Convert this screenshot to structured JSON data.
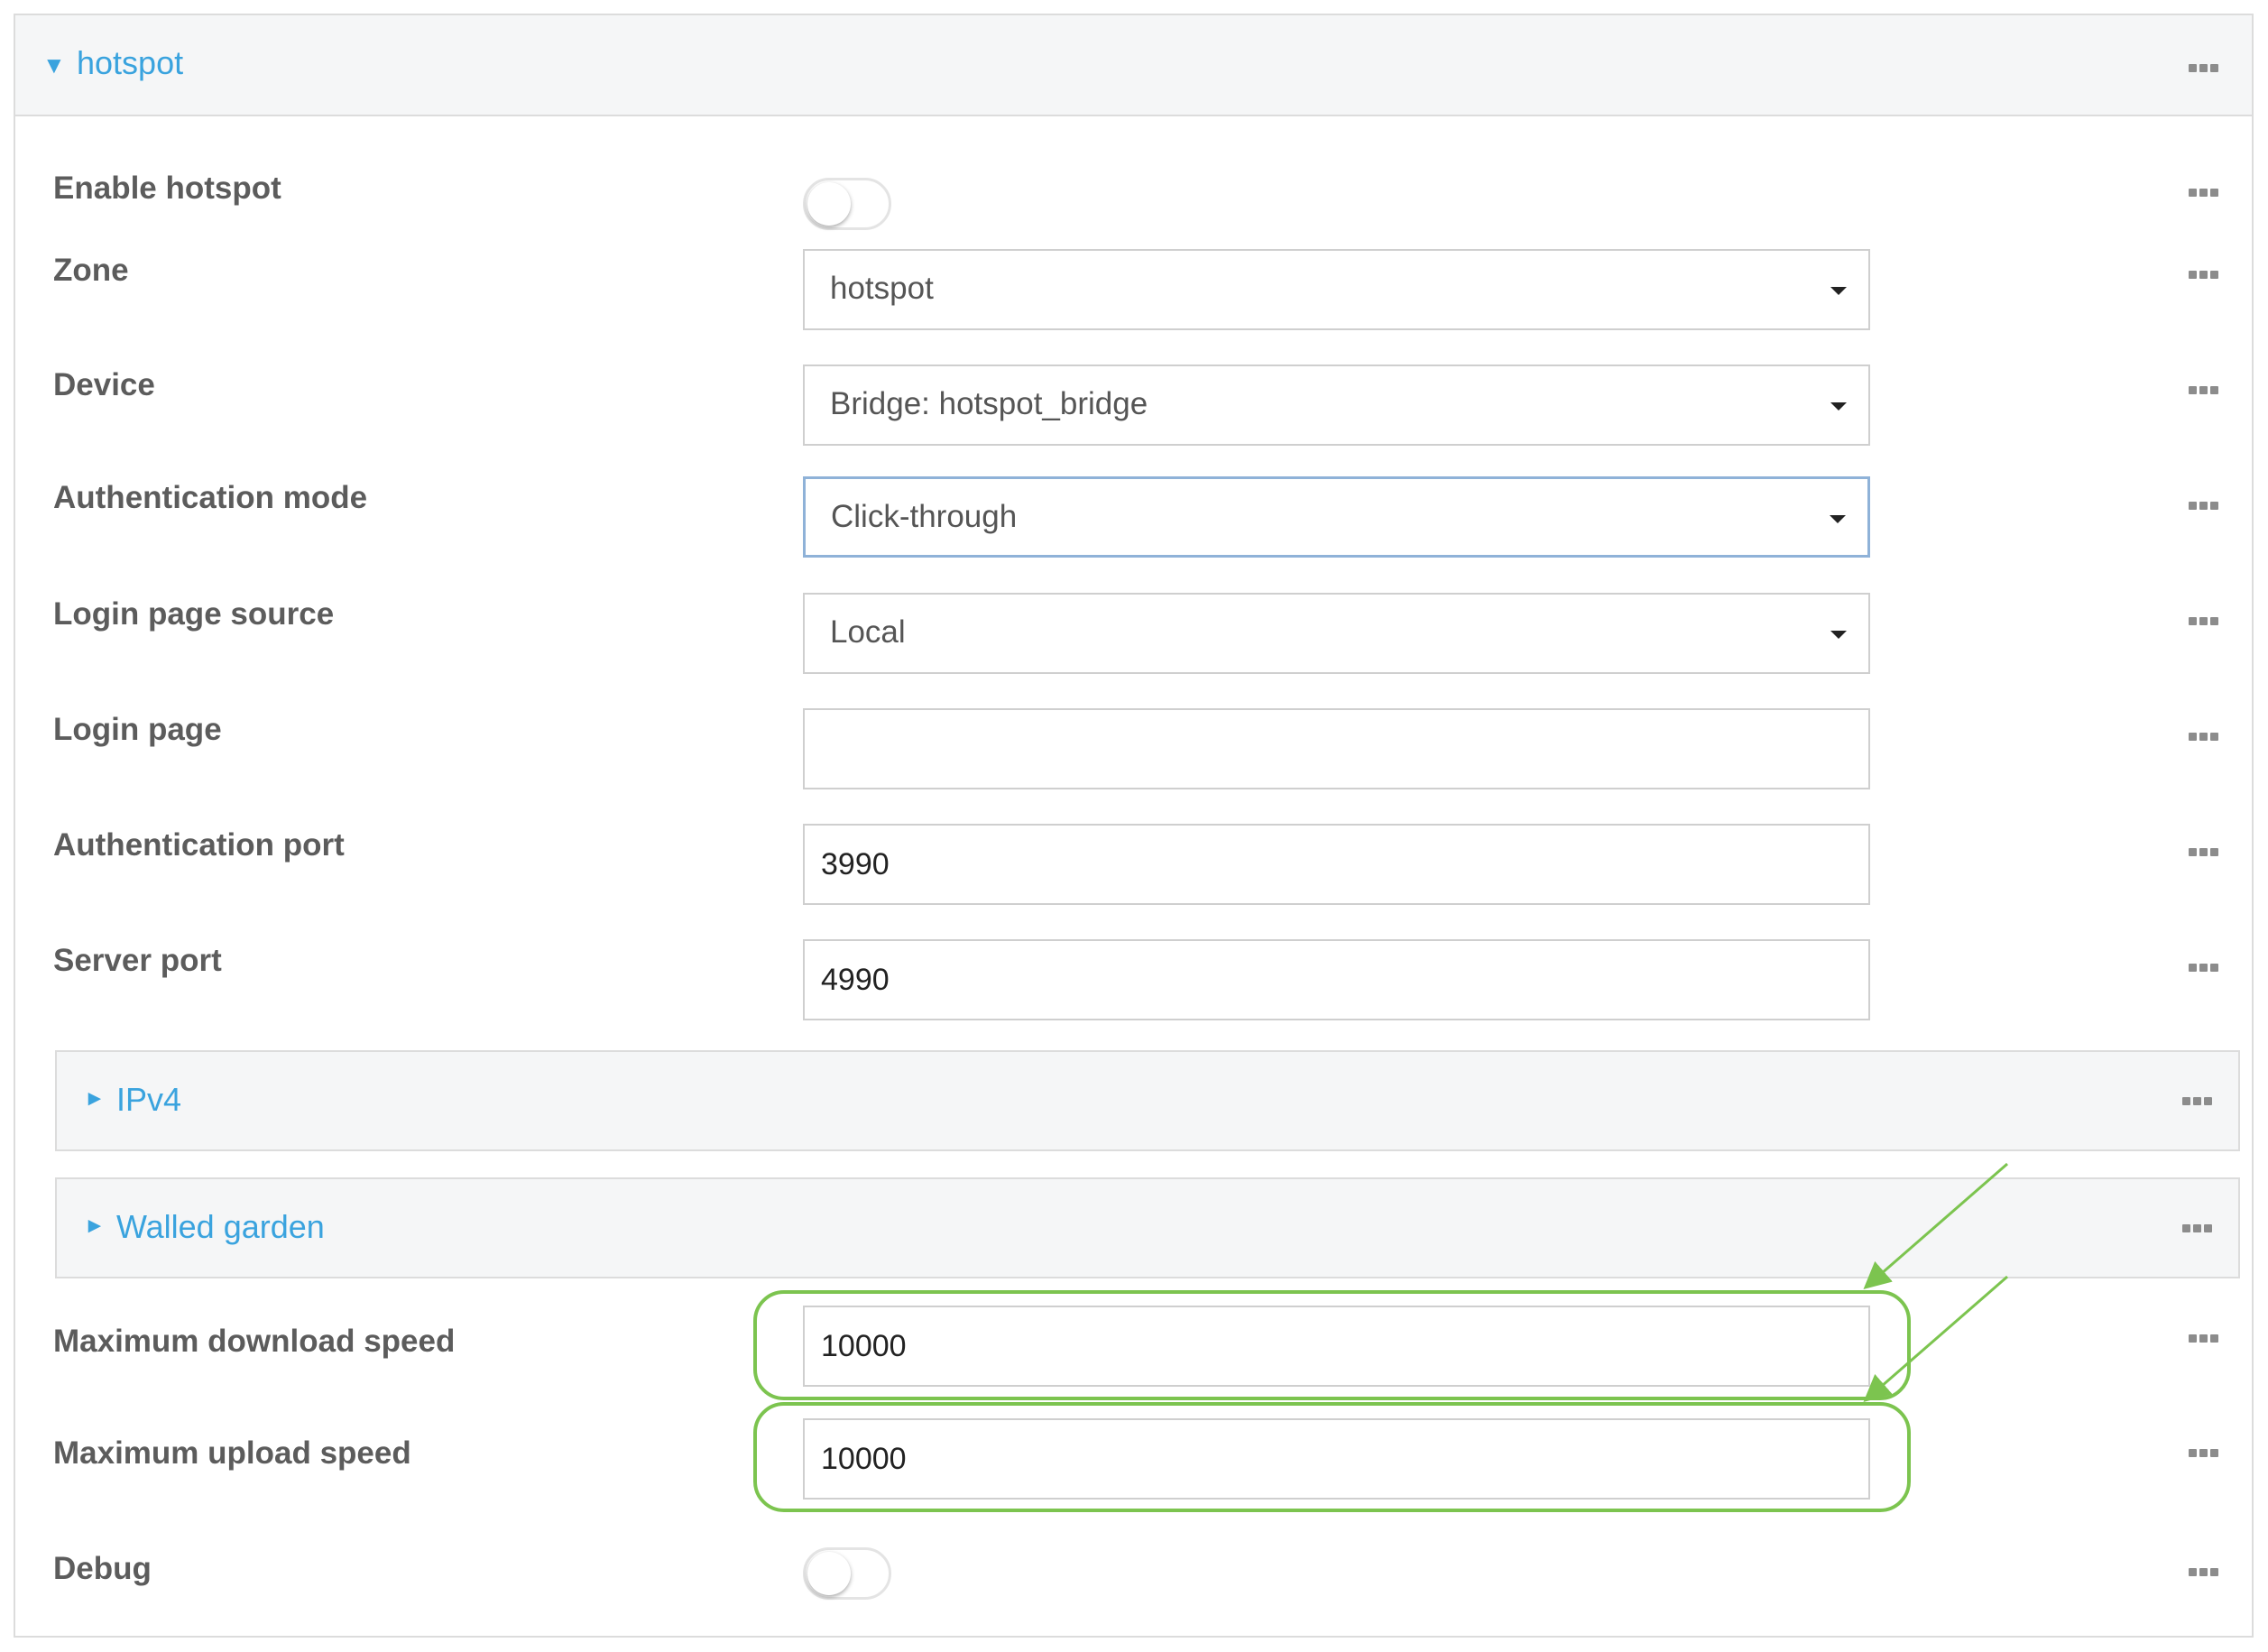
{
  "section": {
    "title": "hotspot"
  },
  "fields": {
    "enable_hotspot": {
      "label": "Enable hotspot",
      "on": false
    },
    "zone": {
      "label": "Zone",
      "value": "hotspot"
    },
    "device": {
      "label": "Device",
      "value": "Bridge: hotspot_bridge"
    },
    "auth_mode": {
      "label": "Authentication mode",
      "value": "Click-through"
    },
    "login_page_source": {
      "label": "Login page source",
      "value": "Local"
    },
    "login_page": {
      "label": "Login page",
      "value": ""
    },
    "auth_port": {
      "label": "Authentication port",
      "value": "3990"
    },
    "server_port": {
      "label": "Server port",
      "value": "4990"
    },
    "max_download": {
      "label": "Maximum download speed",
      "value": "10000"
    },
    "max_upload": {
      "label": "Maximum upload speed",
      "value": "10000"
    },
    "debug": {
      "label": "Debug",
      "on": false
    }
  },
  "subsections": [
    {
      "title": "IPv4"
    },
    {
      "title": "Walled garden"
    }
  ],
  "colors": {
    "accent": "#3aa3de",
    "highlight": "#7cc44f",
    "focus_border": "#8fb2d8"
  },
  "icons": {
    "expanded_caret": "caret-down-icon",
    "collapsed_caret": "caret-right-icon",
    "more": "more-options-icon",
    "dropdown": "dropdown-caret-icon"
  }
}
